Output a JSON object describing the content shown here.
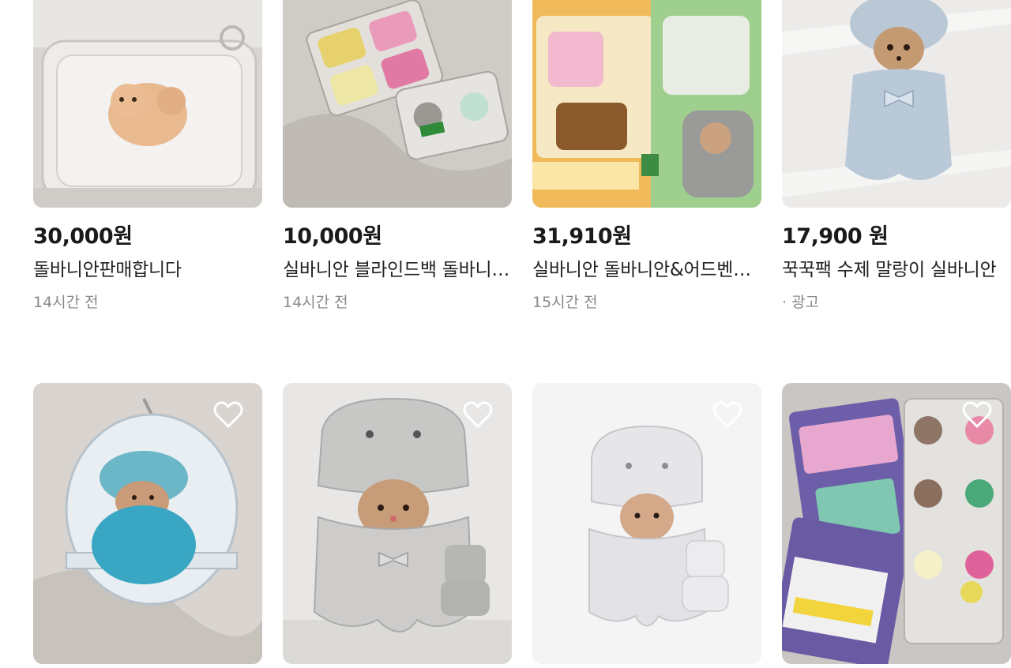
{
  "products_row1": [
    {
      "price": "30,000원",
      "title": "돌바니안판매합니다",
      "time": "14시간 전",
      "image": "sylvanian-baby-figure-in-plastic-case"
    },
    {
      "price": "10,000원",
      "title": "실바니안 블라인드백 돌바니안 세트",
      "time": "14시간 전",
      "image": "sylvanian-blind-bag-figures-in-blister"
    },
    {
      "price": "31,910원",
      "title": "실바니안 돌바니안&어드벤처 세트",
      "time": "15시간 전",
      "image": "sylvanian-package-with-figures"
    },
    {
      "price": "17,900 원",
      "title": "꾹꾹팩 수제 말랑이 실바니안",
      "time": "· 광고",
      "image": "grey-tooth-costume-figure-in-bag"
    }
  ],
  "products_row2": [
    {
      "image": "blue-baby-in-capsule-keychain",
      "heart": "heart-outline-icon"
    },
    {
      "image": "grey-stone-costume-figure-with-mini-doll",
      "heart": "heart-outline-icon"
    },
    {
      "image": "white-tooth-costume-figure",
      "heart": "heart-outline-icon"
    },
    {
      "image": "sylvanian-blind-bags-and-figures",
      "heart": "heart-outline-icon"
    }
  ],
  "colors": {
    "price": "#1a1a1a",
    "muted": "#8a8a8a"
  }
}
